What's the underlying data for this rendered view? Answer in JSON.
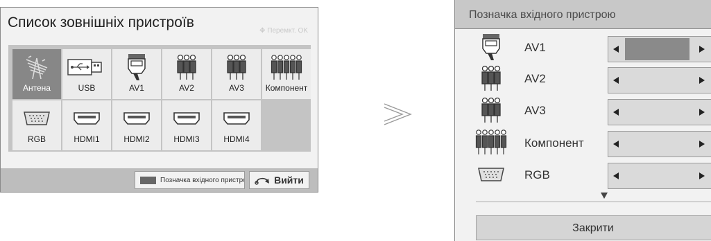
{
  "device_list": {
    "title": "Список зовнішніх пристроїв",
    "hint": "Перемкт. OK",
    "tiles": [
      {
        "label": "Антена",
        "icon": "antenna-icon",
        "selected": true
      },
      {
        "label": "USB",
        "icon": "usb-icon"
      },
      {
        "label": "AV1",
        "icon": "scart-icon"
      },
      {
        "label": "AV2",
        "icon": "rca-icon"
      },
      {
        "label": "AV3",
        "icon": "rca-icon"
      },
      {
        "label": "Компонент",
        "icon": "component-icon"
      },
      {
        "label": "RGB",
        "icon": "vga-icon"
      },
      {
        "label": "HDMI1",
        "icon": "hdmi-icon"
      },
      {
        "label": "HDMI2",
        "icon": "hdmi-icon"
      },
      {
        "label": "HDMI3",
        "icon": "hdmi-icon"
      },
      {
        "label": "HDMI4",
        "icon": "hdmi-icon"
      }
    ],
    "input_label_button": "Позначка вхідного пристрою",
    "exit_button": "Вийти"
  },
  "input_label_dialog": {
    "title": "Позначка вхідного пристрою",
    "rows": [
      {
        "name": "AV1",
        "icon": "scart-icon",
        "value_selected": true
      },
      {
        "name": "AV2",
        "icon": "rca-icon"
      },
      {
        "name": "AV3",
        "icon": "rca-icon"
      },
      {
        "name": "Компонент",
        "icon": "component-icon"
      },
      {
        "name": "RGB",
        "icon": "vga-icon"
      }
    ],
    "close_button": "Закрити"
  },
  "colors": {
    "selected_tile": "#878787",
    "panel_background": "#f2f2f2",
    "grid_background": "#c4c4c4"
  }
}
